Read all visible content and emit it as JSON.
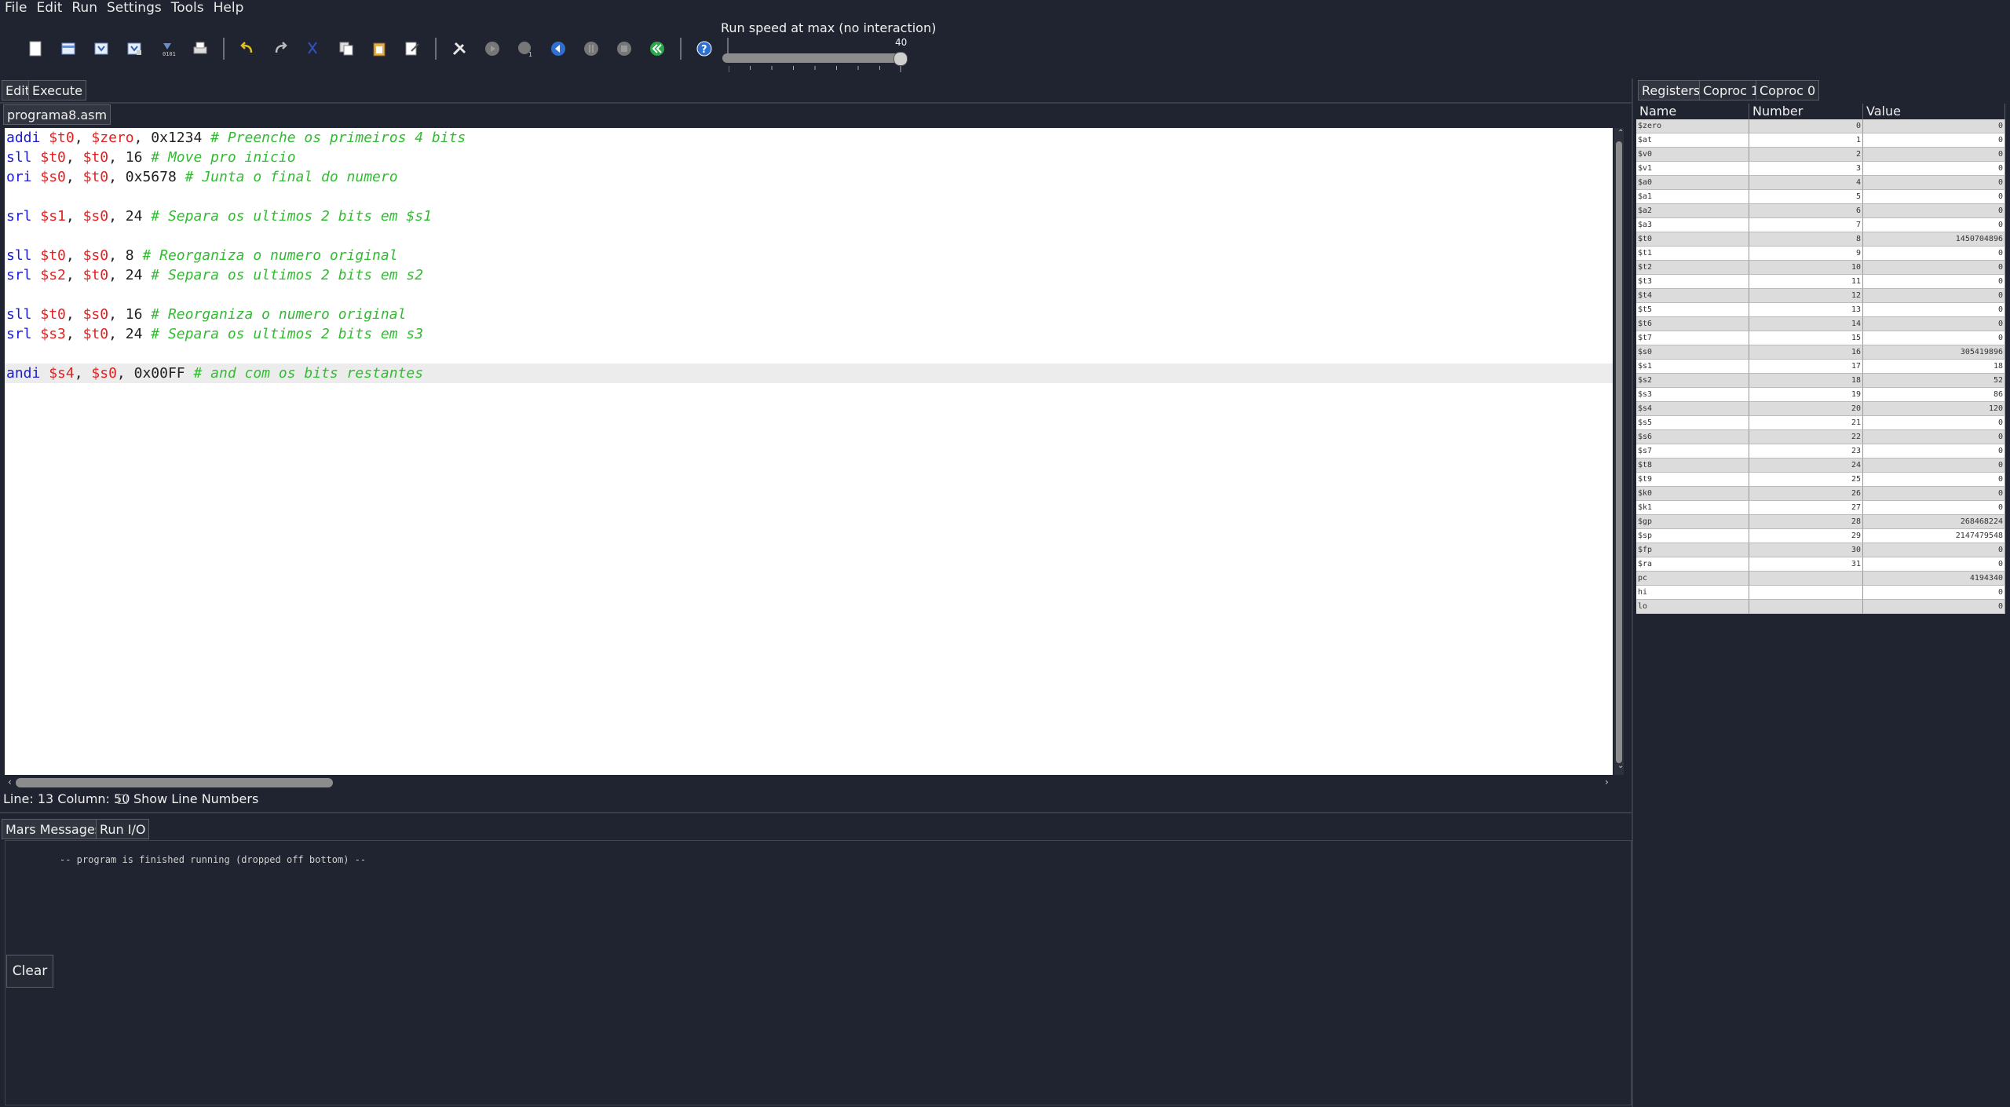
{
  "menu": [
    "File",
    "Edit",
    "Run",
    "Settings",
    "Tools",
    "Help"
  ],
  "toolbar": {
    "icons": [
      "new-file-icon",
      "open-icon",
      "save-icon",
      "save-as-icon",
      "dump-memory-icon",
      "print-icon",
      "undo-icon",
      "redo-icon",
      "cut-icon",
      "copy-icon",
      "paste-icon",
      "find-replace-icon",
      "assemble-icon",
      "run-icon",
      "step-icon",
      "backstep-icon",
      "pause-icon",
      "stop-icon",
      "reset-icon",
      "help-icon"
    ]
  },
  "speed": {
    "label": "Run speed at max (no interaction)",
    "value": "40"
  },
  "main_tabs": [
    "Edit",
    "Execute"
  ],
  "file_tab": "programa8.asm",
  "code": [
    [
      [
        "kw",
        "addi"
      ],
      [
        "pun",
        " "
      ],
      [
        "reg",
        "$t0"
      ],
      [
        "pun",
        ", "
      ],
      [
        "reg",
        "$zero"
      ],
      [
        "pun",
        ", "
      ],
      [
        "num",
        "0x1234"
      ],
      [
        "pun",
        " "
      ],
      [
        "cmt",
        "# Preenche os primeiros 4 bits"
      ]
    ],
    [
      [
        "kw",
        "sll"
      ],
      [
        "pun",
        " "
      ],
      [
        "reg",
        "$t0"
      ],
      [
        "pun",
        ", "
      ],
      [
        "reg",
        "$t0"
      ],
      [
        "pun",
        ", "
      ],
      [
        "num",
        "16"
      ],
      [
        "pun",
        " "
      ],
      [
        "cmt",
        "# Move pro inicio"
      ]
    ],
    [
      [
        "kw",
        "ori"
      ],
      [
        "pun",
        " "
      ],
      [
        "reg",
        "$s0"
      ],
      [
        "pun",
        ", "
      ],
      [
        "reg",
        "$t0"
      ],
      [
        "pun",
        ", "
      ],
      [
        "num",
        "0x5678"
      ],
      [
        "pun",
        " "
      ],
      [
        "cmt",
        "# Junta o final do numero"
      ]
    ],
    [],
    [
      [
        "kw",
        "srl"
      ],
      [
        "pun",
        " "
      ],
      [
        "reg",
        "$s1"
      ],
      [
        "pun",
        ", "
      ],
      [
        "reg",
        "$s0"
      ],
      [
        "pun",
        ", "
      ],
      [
        "num",
        "24"
      ],
      [
        "pun",
        " "
      ],
      [
        "cmt",
        "# Separa os ultimos 2 bits em $s1"
      ]
    ],
    [],
    [
      [
        "kw",
        "sll"
      ],
      [
        "pun",
        " "
      ],
      [
        "reg",
        "$t0"
      ],
      [
        "pun",
        ", "
      ],
      [
        "reg",
        "$s0"
      ],
      [
        "pun",
        ", "
      ],
      [
        "num",
        "8"
      ],
      [
        "pun",
        " "
      ],
      [
        "cmt",
        "# Reorganiza o numero original"
      ]
    ],
    [
      [
        "kw",
        "srl"
      ],
      [
        "pun",
        " "
      ],
      [
        "reg",
        "$s2"
      ],
      [
        "pun",
        ", "
      ],
      [
        "reg",
        "$t0"
      ],
      [
        "pun",
        ", "
      ],
      [
        "num",
        "24"
      ],
      [
        "pun",
        " "
      ],
      [
        "cmt",
        "# Separa os ultimos 2 bits em s2"
      ]
    ],
    [],
    [
      [
        "kw",
        "sll"
      ],
      [
        "pun",
        " "
      ],
      [
        "reg",
        "$t0"
      ],
      [
        "pun",
        ", "
      ],
      [
        "reg",
        "$s0"
      ],
      [
        "pun",
        ", "
      ],
      [
        "num",
        "16"
      ],
      [
        "pun",
        " "
      ],
      [
        "cmt",
        "# Reorganiza o numero original"
      ]
    ],
    [
      [
        "kw",
        "srl"
      ],
      [
        "pun",
        " "
      ],
      [
        "reg",
        "$s3"
      ],
      [
        "pun",
        ", "
      ],
      [
        "reg",
        "$t0"
      ],
      [
        "pun",
        ", "
      ],
      [
        "num",
        "24"
      ],
      [
        "pun",
        " "
      ],
      [
        "cmt",
        "# Separa os ultimos 2 bits em s3"
      ]
    ],
    [],
    [
      [
        "kw",
        "andi"
      ],
      [
        "pun",
        " "
      ],
      [
        "reg",
        "$s4"
      ],
      [
        "pun",
        ", "
      ],
      [
        "reg",
        "$s0"
      ],
      [
        "pun",
        ", "
      ],
      [
        "num",
        "0x00FF"
      ],
      [
        "pun",
        " "
      ],
      [
        "cmt",
        "# and com os bits restantes"
      ]
    ]
  ],
  "highlighted_line": 12,
  "status": {
    "position": "Line: 13 Column: 50",
    "show_line_numbers": "Show Line Numbers"
  },
  "bottom_tabs": [
    "Mars Messages",
    "Run I/O"
  ],
  "messages": "-- program is finished running (dropped off bottom) --",
  "clear_label": "Clear",
  "register_tabs": [
    "Registers",
    "Coproc 1",
    "Coproc 0"
  ],
  "register_columns": [
    "Name",
    "Number",
    "Value"
  ],
  "registers": [
    [
      "$zero",
      "0",
      "0"
    ],
    [
      "$at",
      "1",
      "0"
    ],
    [
      "$v0",
      "2",
      "0"
    ],
    [
      "$v1",
      "3",
      "0"
    ],
    [
      "$a0",
      "4",
      "0"
    ],
    [
      "$a1",
      "5",
      "0"
    ],
    [
      "$a2",
      "6",
      "0"
    ],
    [
      "$a3",
      "7",
      "0"
    ],
    [
      "$t0",
      "8",
      "1450704896"
    ],
    [
      "$t1",
      "9",
      "0"
    ],
    [
      "$t2",
      "10",
      "0"
    ],
    [
      "$t3",
      "11",
      "0"
    ],
    [
      "$t4",
      "12",
      "0"
    ],
    [
      "$t5",
      "13",
      "0"
    ],
    [
      "$t6",
      "14",
      "0"
    ],
    [
      "$t7",
      "15",
      "0"
    ],
    [
      "$s0",
      "16",
      "305419896"
    ],
    [
      "$s1",
      "17",
      "18"
    ],
    [
      "$s2",
      "18",
      "52"
    ],
    [
      "$s3",
      "19",
      "86"
    ],
    [
      "$s4",
      "20",
      "120"
    ],
    [
      "$s5",
      "21",
      "0"
    ],
    [
      "$s6",
      "22",
      "0"
    ],
    [
      "$s7",
      "23",
      "0"
    ],
    [
      "$t8",
      "24",
      "0"
    ],
    [
      "$t9",
      "25",
      "0"
    ],
    [
      "$k0",
      "26",
      "0"
    ],
    [
      "$k1",
      "27",
      "0"
    ],
    [
      "$gp",
      "28",
      "268468224"
    ],
    [
      "$sp",
      "29",
      "2147479548"
    ],
    [
      "$fp",
      "30",
      "0"
    ],
    [
      "$ra",
      "31",
      "0"
    ],
    [
      "pc",
      "",
      "4194340"
    ],
    [
      "hi",
      "",
      "0"
    ],
    [
      "lo",
      "",
      "0"
    ]
  ]
}
